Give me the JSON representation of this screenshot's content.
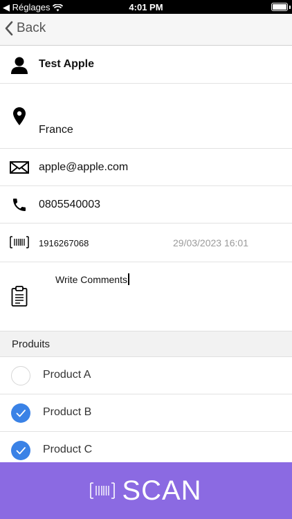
{
  "status": {
    "carrier": "◀ Réglages",
    "time": "4:01 PM"
  },
  "nav": {
    "back_label": "Back"
  },
  "contact": {
    "name": "Test Apple",
    "location": "France",
    "email": "apple@apple.com",
    "phone": "0805540003",
    "barcode": "1916267068",
    "datetime": "29/03/2023 16:01",
    "comment_value": "Write Comments"
  },
  "products": {
    "header": "Produits",
    "items": [
      {
        "label": "Product A",
        "checked": false
      },
      {
        "label": "Product B",
        "checked": true
      },
      {
        "label": "Product C",
        "checked": true
      }
    ]
  },
  "scan": {
    "label": "SCAN"
  },
  "colors": {
    "accent": "#8b6ae2",
    "check": "#3a82e6"
  }
}
